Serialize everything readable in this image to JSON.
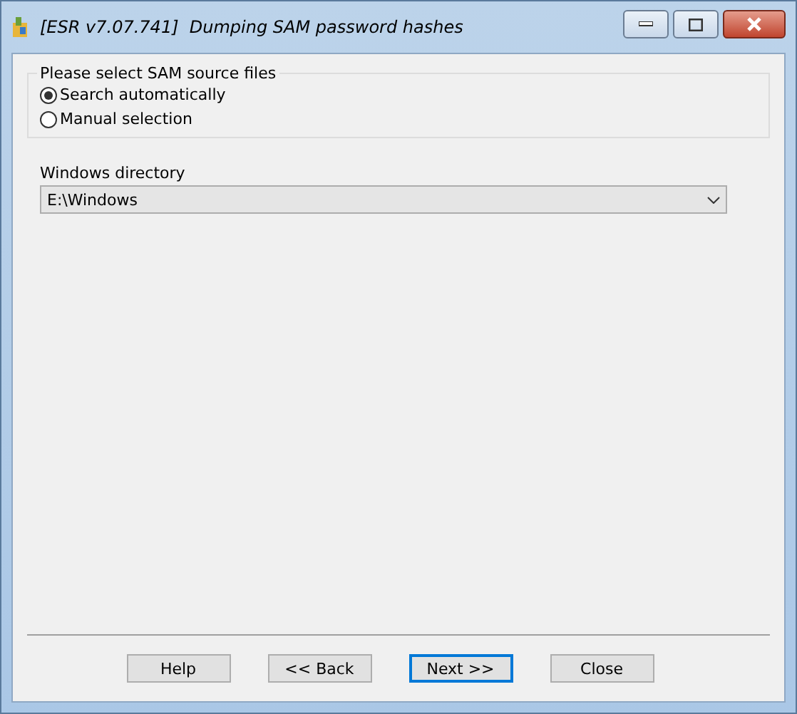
{
  "window": {
    "title": "[ESR v7.07.741]  Dumping SAM password hashes"
  },
  "source_group": {
    "title": "Please select SAM source files",
    "options": [
      {
        "label": "Search automatically",
        "selected": true
      },
      {
        "label": "Manual selection",
        "selected": false
      }
    ]
  },
  "windows_directory": {
    "label": "Windows directory",
    "value": "E:\\Windows"
  },
  "buttons": [
    {
      "label": "Help",
      "focused": false
    },
    {
      "label": "<< Back",
      "focused": false
    },
    {
      "label": "Next >>",
      "focused": true
    },
    {
      "label": "Close",
      "focused": false
    }
  ]
}
